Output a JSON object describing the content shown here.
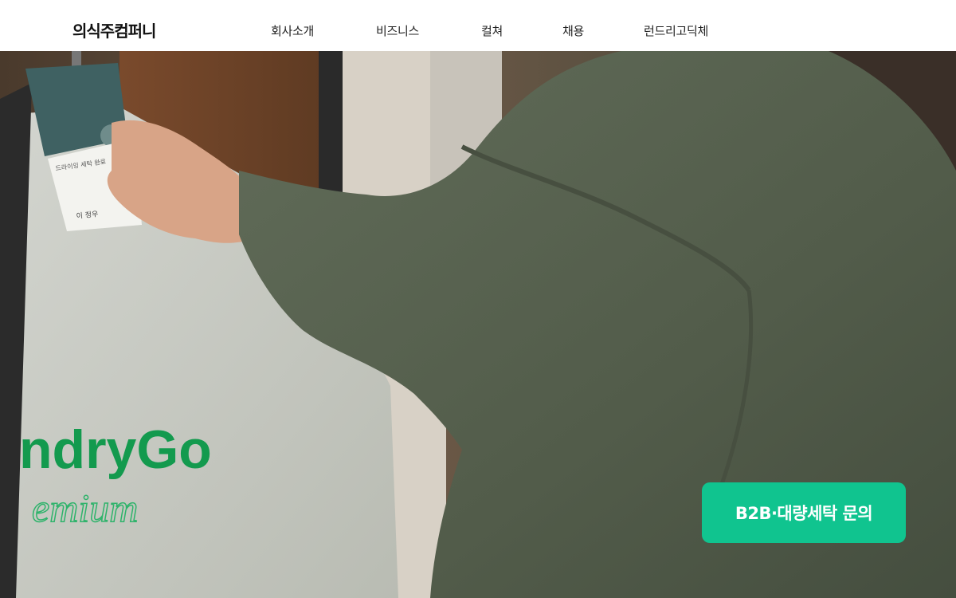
{
  "header": {
    "logo": "의식주컴퍼니",
    "nav": [
      {
        "label": "회사소개"
      },
      {
        "label": "비즈니스"
      },
      {
        "label": "컬쳐"
      },
      {
        "label": "채용"
      },
      {
        "label": "런드리고딕체"
      }
    ]
  },
  "hero": {
    "bag_brand": "ndryGo",
    "bag_sub": "emium",
    "tag_title": "드라이잉 세탁 완료",
    "tag_signature": "이 정우",
    "cta_label": "B2B·대량세탁 문의"
  },
  "colors": {
    "accent": "#10C48F",
    "brand_green": "#139A4E",
    "sweater": "#56604F",
    "bag": "#C9CCC4"
  }
}
